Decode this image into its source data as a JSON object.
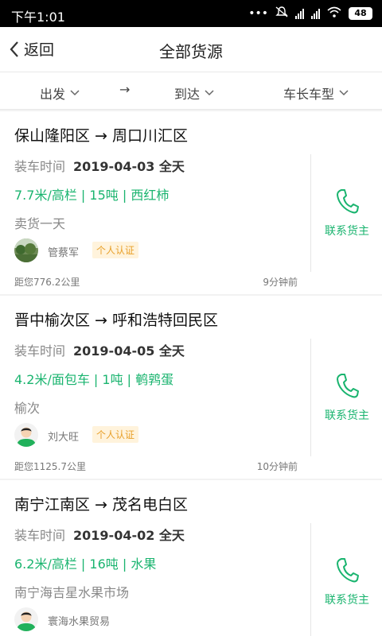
{
  "status_bar": {
    "time": "下午1:01",
    "battery": "48"
  },
  "nav": {
    "back_label": "返回",
    "title": "全部货源"
  },
  "filters": {
    "depart": "出发",
    "arrow": "→",
    "arrive": "到达",
    "vehicle": "车长车型"
  },
  "cards": [
    {
      "route": "保山隆阳区 → 周口川汇区",
      "load_label": "装车时间",
      "load_time": "2019-04-03 全天",
      "spec": "7.7米/高栏 | 15吨 | 西红柿",
      "remark": "卖货一天",
      "owner": "管蔡军",
      "cert": "个人认证",
      "distance": "距您776.2公里",
      "ago": "9分钟前",
      "contact": "联系货主"
    },
    {
      "route": "晋中榆次区 → 呼和浩特回民区",
      "load_label": "装车时间",
      "load_time": "2019-04-05 全天",
      "spec": "4.2米/面包车 | 1吨 | 鹌鹑蛋",
      "remark": "榆次",
      "owner": "刘大旺",
      "cert": "个人认证",
      "distance": "距您1125.7公里",
      "ago": "10分钟前",
      "contact": "联系货主"
    },
    {
      "route": "南宁江南区 → 茂名电白区",
      "load_label": "装车时间",
      "load_time": "2019-04-02 全天",
      "spec": "6.2米/高栏 | 16吨 | 水果",
      "remark": "南宁海吉星水果市场",
      "owner": "寰海水果贸易",
      "contact": "联系货主"
    }
  ],
  "colors": {
    "accent": "#1ab46f",
    "cert_text": "#e8a02a",
    "cert_bg": "#fff3dc"
  },
  "icons": {
    "back": "chevron-left-icon",
    "dropdown": "chevron-down-icon",
    "contact": "phone-icon"
  }
}
